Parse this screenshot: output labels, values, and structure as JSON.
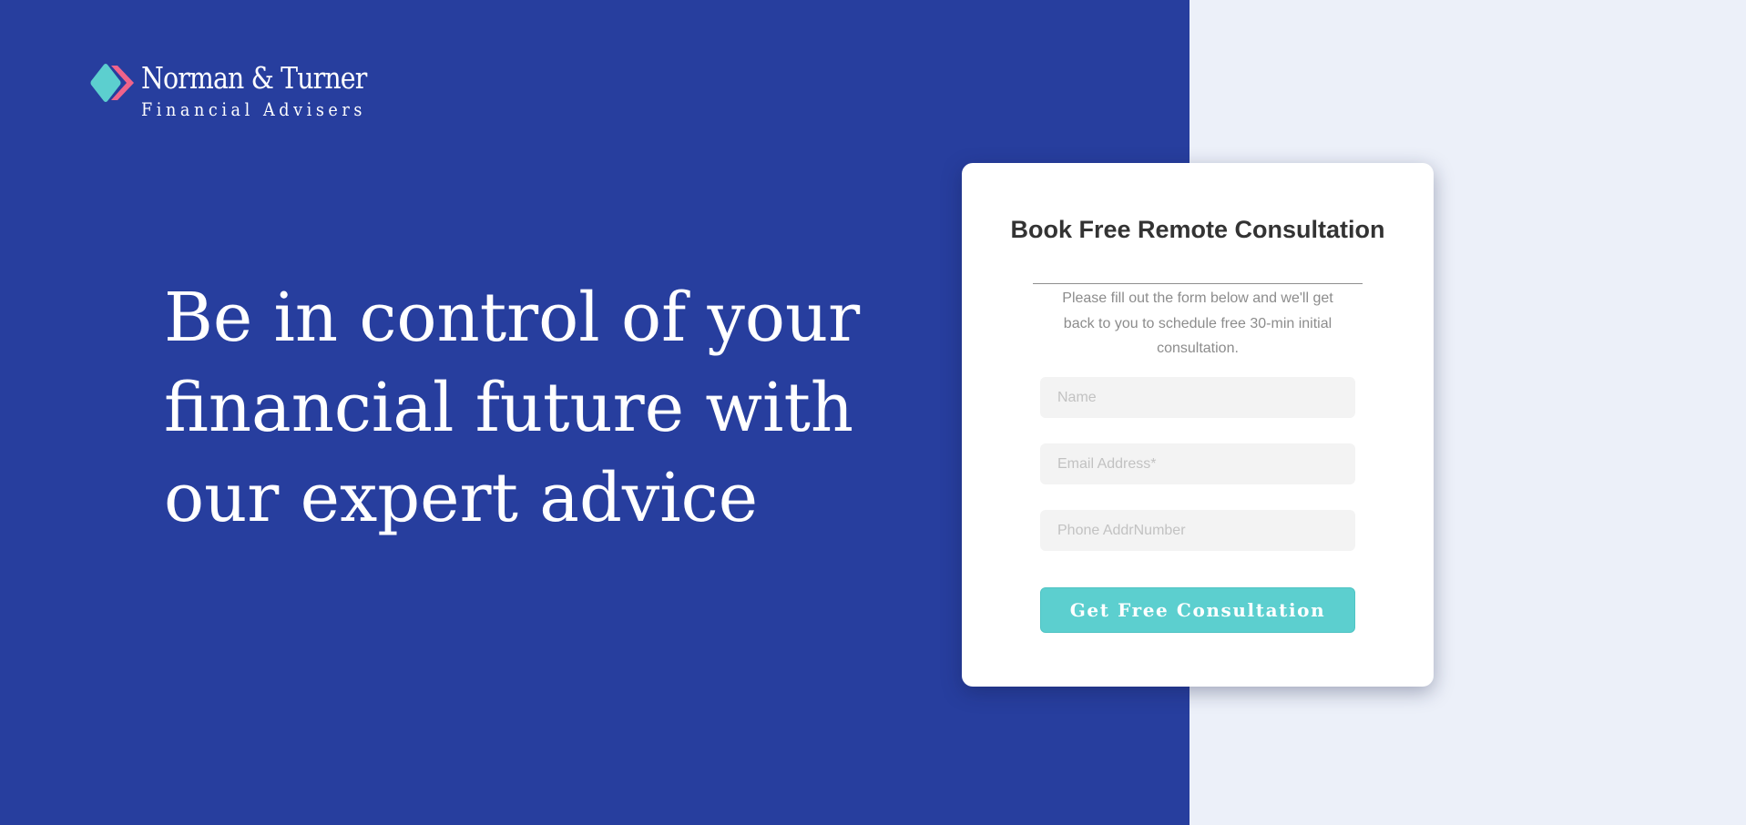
{
  "brand": {
    "name": "Norman & Turner",
    "tagline": "Financial Advisers",
    "logo_icon": "double-chevron-diamond-icon",
    "colors": {
      "primary_blue": "#273e9e",
      "accent_teal": "#5ccfcf",
      "accent_pink": "#f0638a"
    }
  },
  "hero": {
    "headline_lines": [
      "Be in control of your",
      "financial future with",
      "our expert advice"
    ]
  },
  "form": {
    "title": "Book Free Remote Consultation",
    "description": "Please fill out the form below and we'll get back to you to schedule free 30-min initial consultation.",
    "fields": {
      "name": {
        "placeholder": "Name",
        "value": ""
      },
      "email": {
        "placeholder": "Email Address*",
        "value": ""
      },
      "phone": {
        "placeholder": "Phone AddrNumber",
        "value": ""
      }
    },
    "submit_label": "Get Free Consultation"
  }
}
